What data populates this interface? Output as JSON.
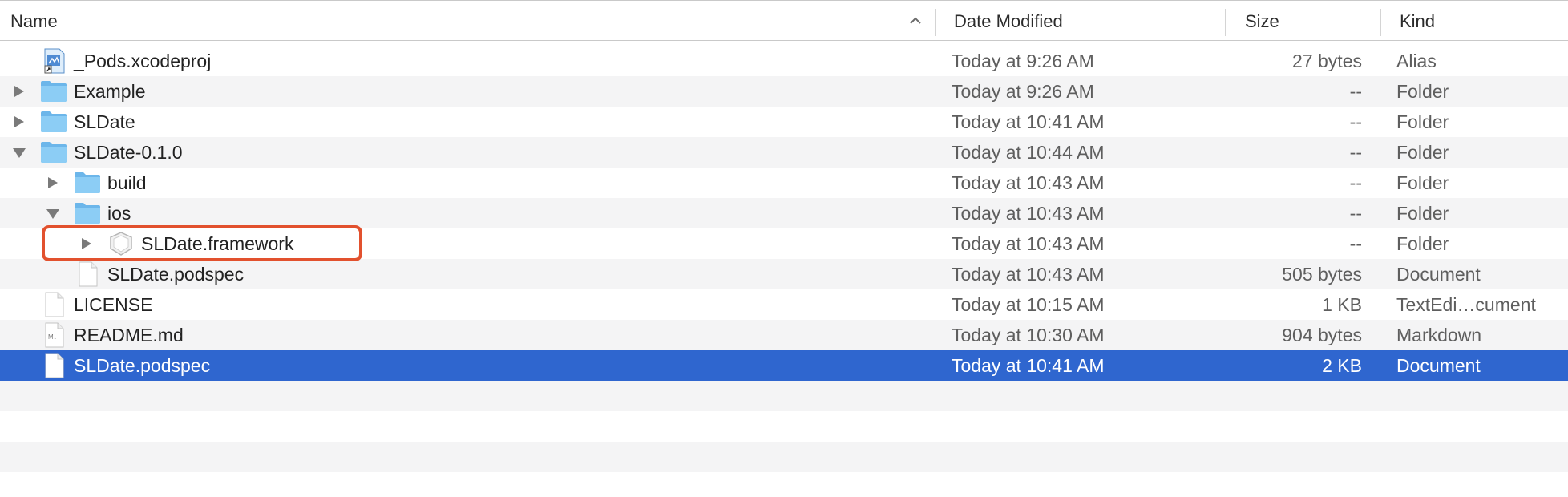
{
  "columns": {
    "name": "Name",
    "date": "Date Modified",
    "size": "Size",
    "kind": "Kind"
  },
  "colors": {
    "selection": "#2f66cf",
    "folder": "#7ec3ef",
    "highlight_box": "#e2512e",
    "stripe": "#f4f4f5"
  },
  "files": [
    {
      "name": "_Pods.xcodeproj",
      "date": "Today at 9:26 AM",
      "size": "27 bytes",
      "kind": "Alias",
      "icon": "xcodeproj-alias-icon",
      "disclosure": "none",
      "depth": 0
    },
    {
      "name": "Example",
      "date": "Today at 9:26 AM",
      "size": "--",
      "kind": "Folder",
      "icon": "folder-icon",
      "disclosure": "collapsed",
      "depth": 0
    },
    {
      "name": "SLDate",
      "date": "Today at 10:41 AM",
      "size": "--",
      "kind": "Folder",
      "icon": "folder-icon",
      "disclosure": "collapsed",
      "depth": 0
    },
    {
      "name": "SLDate-0.1.0",
      "date": "Today at 10:44 AM",
      "size": "--",
      "kind": "Folder",
      "icon": "folder-icon",
      "disclosure": "expanded",
      "depth": 0
    },
    {
      "name": "build",
      "date": "Today at 10:43 AM",
      "size": "--",
      "kind": "Folder",
      "icon": "folder-icon",
      "disclosure": "collapsed",
      "depth": 1
    },
    {
      "name": "ios",
      "date": "Today at 10:43 AM",
      "size": "--",
      "kind": "Folder",
      "icon": "folder-icon",
      "disclosure": "expanded",
      "depth": 1
    },
    {
      "name": "SLDate.framework",
      "date": "Today at 10:43 AM",
      "size": "--",
      "kind": "Folder",
      "icon": "framework-icon",
      "disclosure": "collapsed",
      "depth": 2
    },
    {
      "name": "SLDate.podspec",
      "date": "Today at 10:43 AM",
      "size": "505 bytes",
      "kind": "Document",
      "icon": "document-icon",
      "disclosure": "none",
      "depth": 1
    },
    {
      "name": "LICENSE",
      "date": "Today at 10:15 AM",
      "size": "1 KB",
      "kind": "TextEdi…cument",
      "icon": "document-icon",
      "disclosure": "none",
      "depth": 0
    },
    {
      "name": "README.md",
      "date": "Today at 10:30 AM",
      "size": "904 bytes",
      "kind": "Markdown",
      "icon": "markdown-icon",
      "disclosure": "none",
      "depth": 0
    },
    {
      "name": "SLDate.podspec",
      "date": "Today at 10:41 AM",
      "size": "2 KB",
      "kind": "Document",
      "icon": "document-icon",
      "disclosure": "none",
      "depth": 0,
      "selected": true
    }
  ],
  "annotation": {
    "highlighted_item": "SLDate.framework"
  }
}
